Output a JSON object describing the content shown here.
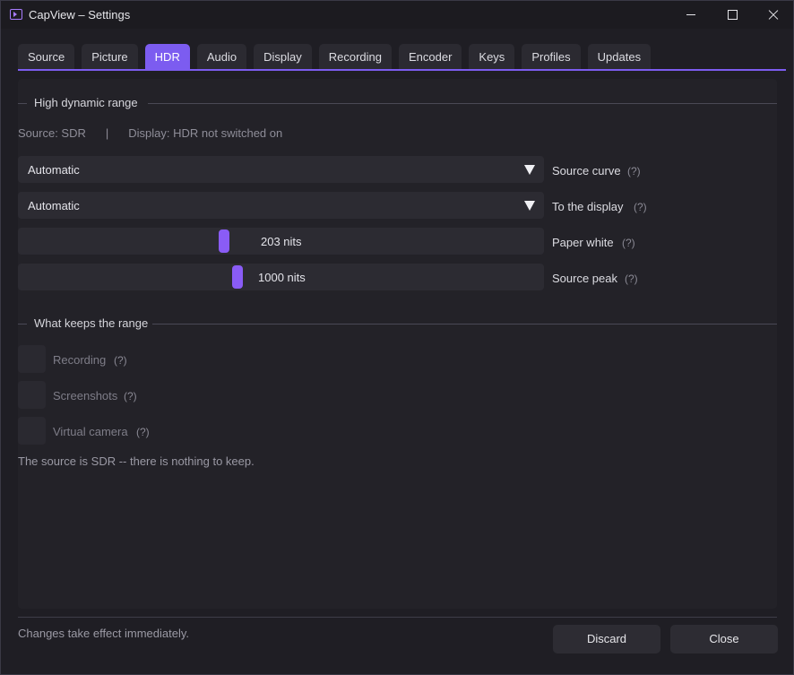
{
  "window": {
    "title": "CapView – Settings"
  },
  "tabs": [
    {
      "label": "Source"
    },
    {
      "label": "Picture"
    },
    {
      "label": "HDR"
    },
    {
      "label": "Audio"
    },
    {
      "label": "Display"
    },
    {
      "label": "Recording"
    },
    {
      "label": "Encoder"
    },
    {
      "label": "Keys"
    },
    {
      "label": "Profiles"
    },
    {
      "label": "Updates"
    }
  ],
  "active_tab": "HDR",
  "hdr": {
    "section_title": "High dynamic range",
    "status_source": "Source: SDR",
    "status_separator": "|",
    "status_display": "Display: HDR not switched on",
    "source_curve": {
      "value": "Automatic",
      "label": "Source curve",
      "help": "(?)"
    },
    "to_display": {
      "value": "Automatic",
      "label": "To the display",
      "help": "(?)"
    },
    "paper_white": {
      "value_text": "203 nits",
      "fraction": 0.39,
      "label": "Paper white",
      "help": "(?)"
    },
    "source_peak": {
      "value_text": "1000 nits",
      "fraction": 0.415,
      "label": "Source peak",
      "help": "(?)"
    }
  },
  "keeps": {
    "section_title": "What keeps the range",
    "items": [
      {
        "label": "Recording",
        "help": "(?)",
        "checked": false
      },
      {
        "label": "Screenshots",
        "help": "(?)",
        "checked": false
      },
      {
        "label": "Virtual camera",
        "help": "(?)",
        "checked": false
      }
    ],
    "note": "The source is SDR -- there is nothing to keep."
  },
  "footer": {
    "note": "Changes take effect immediately.",
    "discard_label": "Discard",
    "close_label": "Close"
  },
  "colors": {
    "accent": "#7c5cf0",
    "slider_thumb": "#8a5cf6",
    "background": "#1f1e24"
  }
}
